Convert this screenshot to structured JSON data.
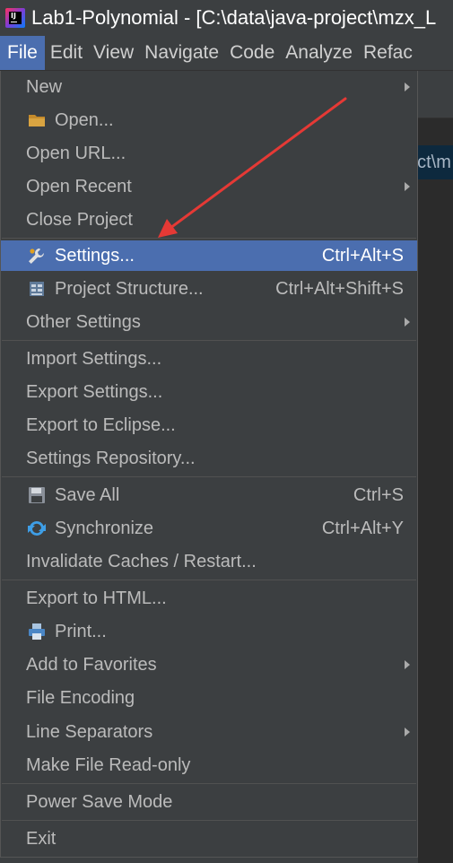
{
  "window": {
    "title": "Lab1-Polynomial - [C:\\data\\java-project\\mzx_L"
  },
  "menubar": {
    "items": [
      "File",
      "Edit",
      "View",
      "Navigate",
      "Code",
      "Analyze",
      "Refac"
    ]
  },
  "background": {
    "path_fragment": "ect\\m"
  },
  "file_menu": {
    "new": "New",
    "open": "Open...",
    "open_url": "Open URL...",
    "open_recent": "Open Recent",
    "close_project": "Close Project",
    "settings": "Settings...",
    "settings_shortcut": "Ctrl+Alt+S",
    "project_structure": "Project Structure...",
    "project_structure_shortcut": "Ctrl+Alt+Shift+S",
    "other_settings": "Other Settings",
    "import_settings": "Import Settings...",
    "export_settings": "Export Settings...",
    "export_eclipse": "Export to Eclipse...",
    "settings_repository": "Settings Repository...",
    "save_all": "Save All",
    "save_all_shortcut": "Ctrl+S",
    "synchronize": "Synchronize",
    "synchronize_shortcut": "Ctrl+Alt+Y",
    "invalidate_caches": "Invalidate Caches / Restart...",
    "export_html": "Export to HTML...",
    "print": "Print...",
    "add_favorites": "Add to Favorites",
    "file_encoding": "File Encoding",
    "line_separators": "Line Separators",
    "make_readonly": "Make File Read-only",
    "power_save": "Power Save Mode",
    "exit": "Exit"
  },
  "colors": {
    "selection": "#4b6eaf",
    "menu_bg": "#3c3f41",
    "annotation_arrow": "#e53935"
  }
}
